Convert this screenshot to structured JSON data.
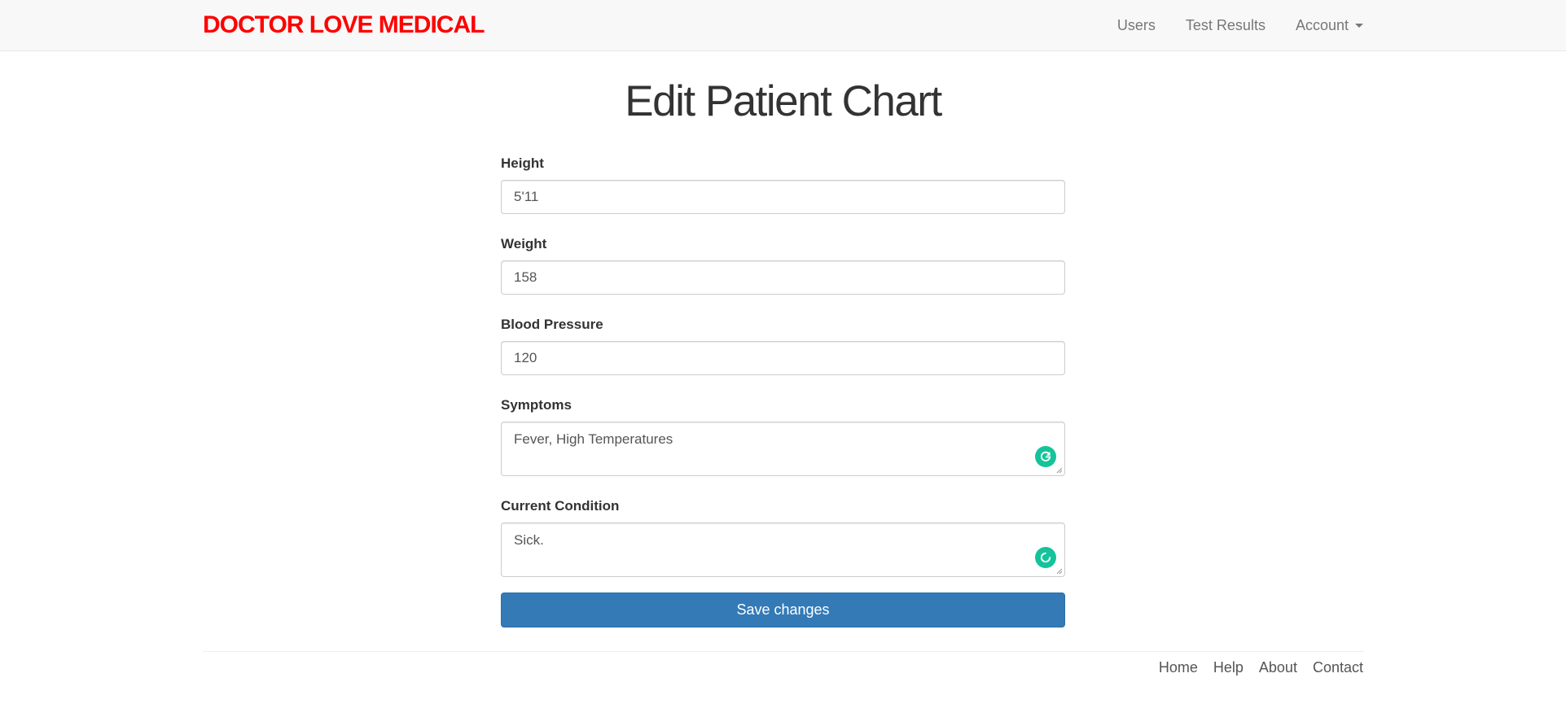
{
  "navbar": {
    "brand": "DOCTOR LOVE MEDICAL",
    "brand_color": "#ff0000",
    "items": [
      {
        "label": "Users"
      },
      {
        "label": "Test Results"
      },
      {
        "label": "Account",
        "dropdown": true
      }
    ]
  },
  "page": {
    "title": "Edit Patient Chart"
  },
  "form": {
    "height": {
      "label": "Height",
      "value": "5'11"
    },
    "weight": {
      "label": "Weight",
      "value": "158"
    },
    "blood_pressure": {
      "label": "Blood Pressure",
      "value": "120"
    },
    "symptoms": {
      "label": "Symptoms",
      "value": "Fever, High Temperatures",
      "icon": "grammarly-icon"
    },
    "current_condition": {
      "label": "Current Condition",
      "value": "Sick.",
      "icon": "grammarly-loading-icon"
    },
    "save_label": "Save changes",
    "save_color": "#337ab7"
  },
  "footer": {
    "links": [
      {
        "label": "Home"
      },
      {
        "label": "Help"
      },
      {
        "label": "About"
      },
      {
        "label": "Contact"
      }
    ]
  }
}
